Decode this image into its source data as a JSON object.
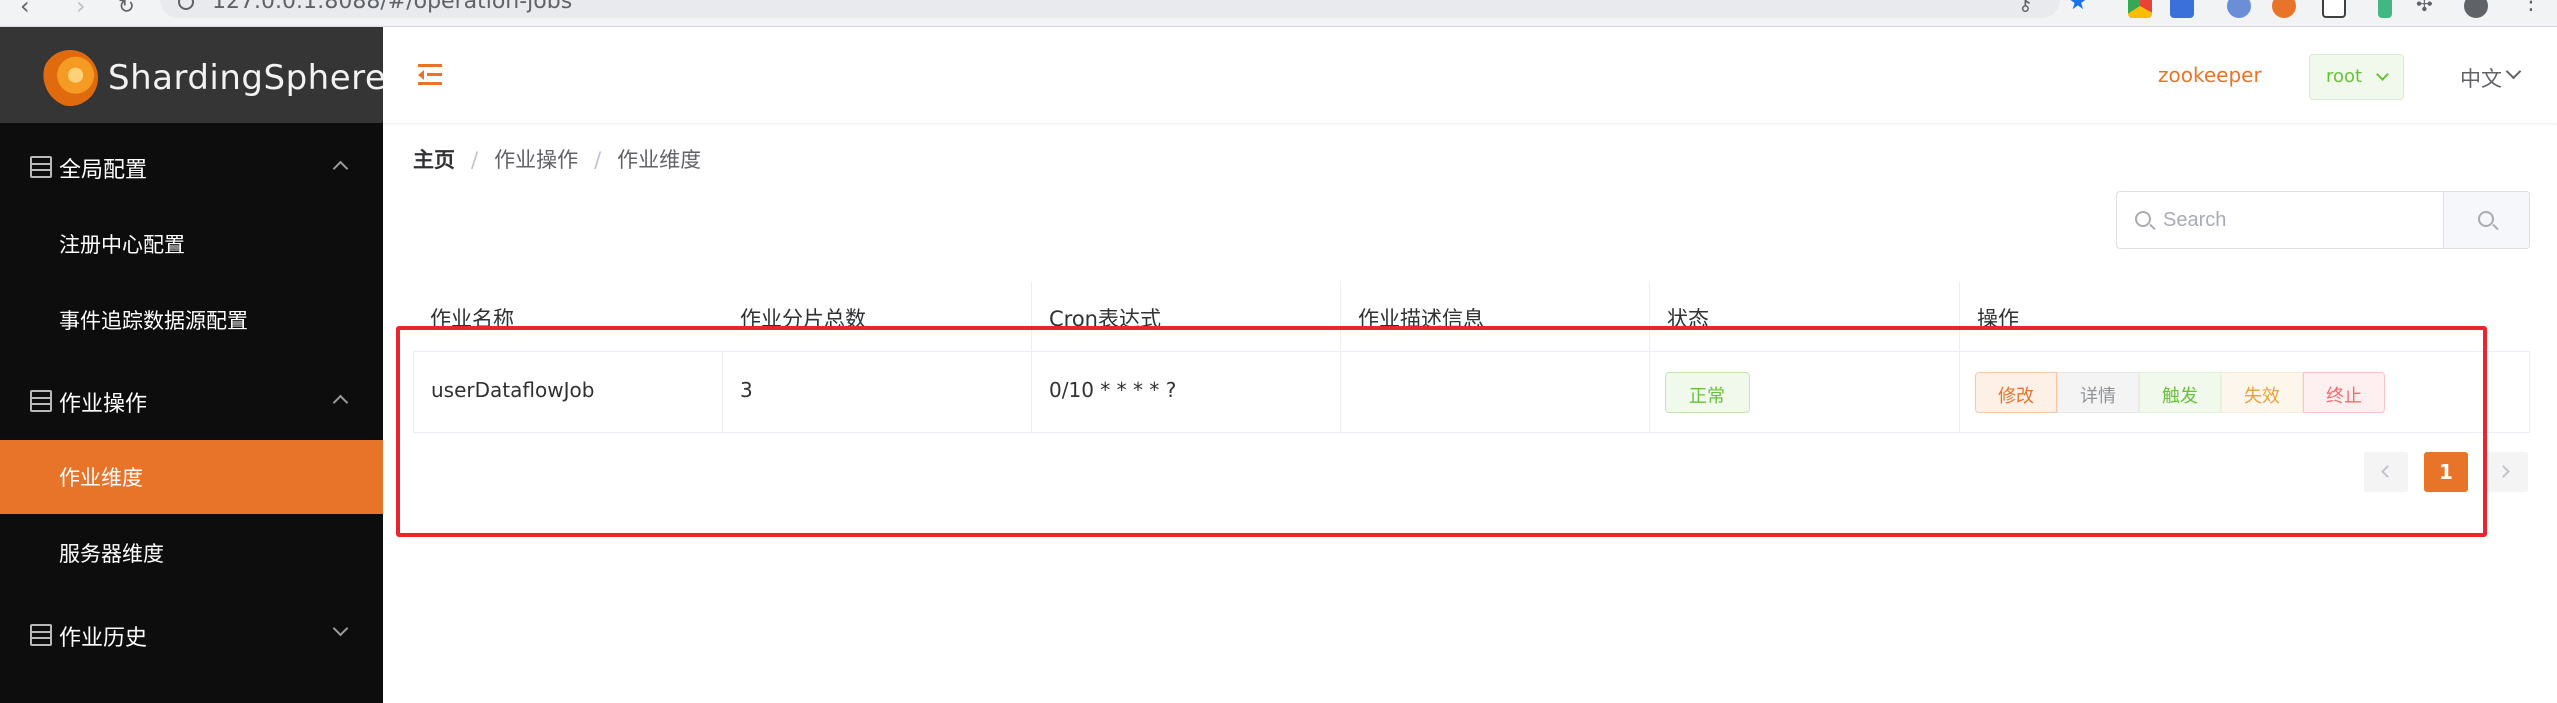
{
  "browser": {
    "url": "127.0.0.1:8088/#/operation-jobs"
  },
  "brand": {
    "name": "ShardingSphere"
  },
  "sidebar": {
    "groups": [
      {
        "label": "全局配置",
        "expanded": true,
        "items": [
          {
            "label": "注册中心配置"
          },
          {
            "label": "事件追踪数据源配置"
          }
        ]
      },
      {
        "label": "作业操作",
        "expanded": true,
        "items": [
          {
            "label": "作业维度",
            "active": true
          },
          {
            "label": "服务器维度"
          }
        ]
      },
      {
        "label": "作业历史",
        "expanded": false,
        "items": []
      }
    ]
  },
  "header": {
    "registry": "zookeeper",
    "user": "root",
    "language": "中文"
  },
  "breadcrumb": [
    "主页",
    "作业操作",
    "作业维度"
  ],
  "search": {
    "placeholder": "Search",
    "value": ""
  },
  "table": {
    "columns": [
      "作业名称",
      "作业分片总数",
      "Cron表达式",
      "作业描述信息",
      "状态",
      "操作"
    ],
    "rows": [
      {
        "name": "userDataflowJob",
        "sharding_total": "3",
        "cron": "0/10 * * * * ?",
        "description": "",
        "status": "正常",
        "actions": [
          "修改",
          "详情",
          "触发",
          "失效",
          "终止"
        ]
      }
    ]
  },
  "pagination": {
    "current": "1"
  },
  "colors": {
    "accent": "#e8742a",
    "sidebar_bg": "#0d0d0d",
    "success": "#67c23a",
    "danger": "#f56c6c",
    "annotation": "#e8262c"
  }
}
